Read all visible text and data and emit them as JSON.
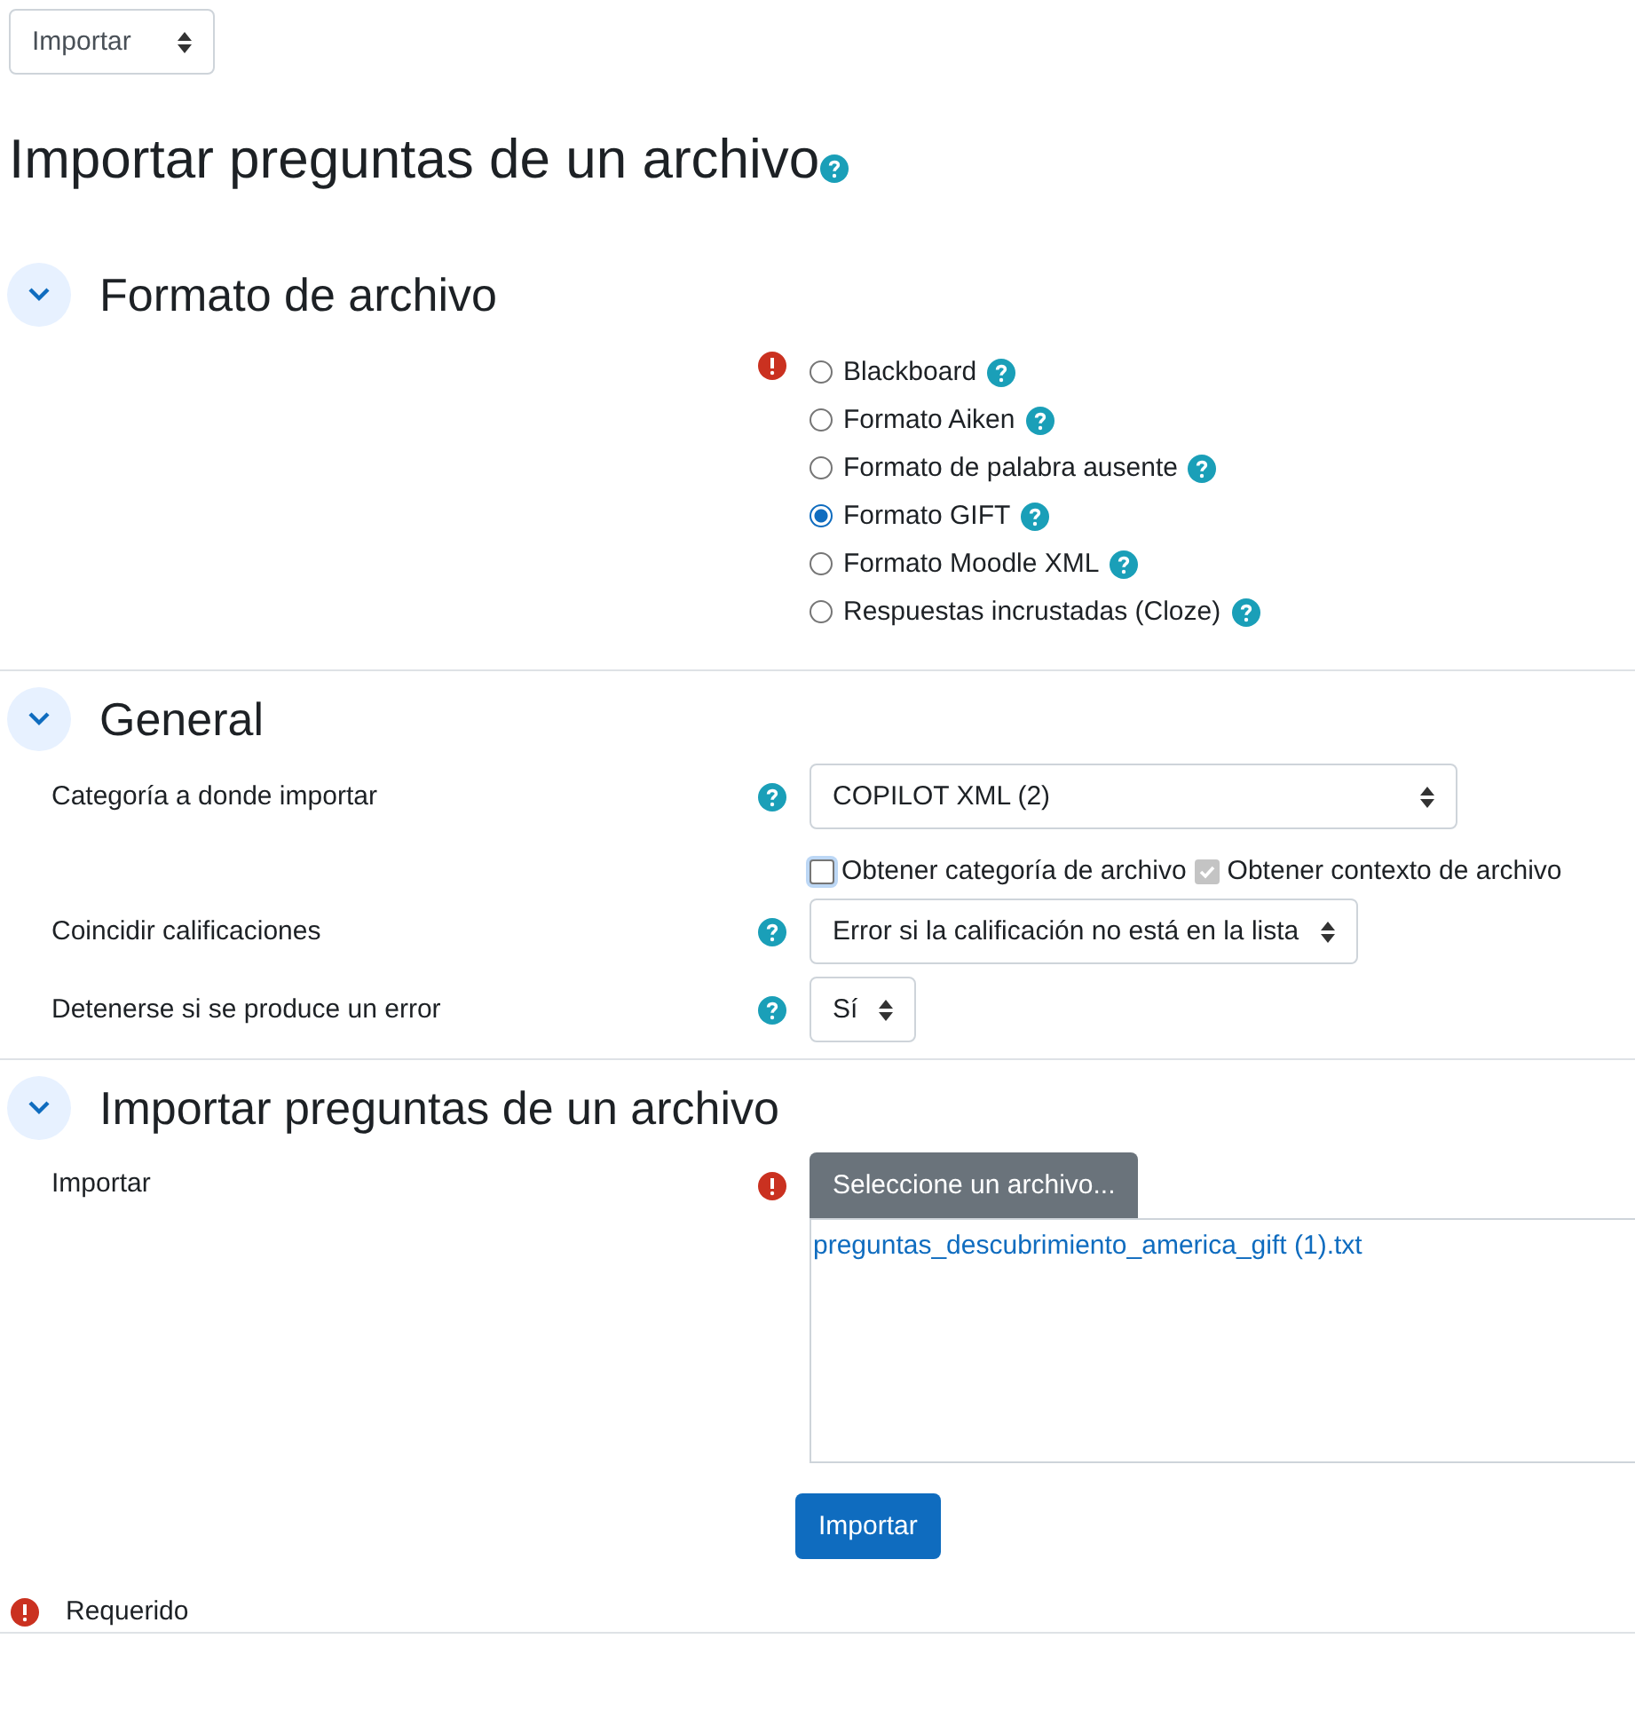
{
  "jump_select": {
    "value": "Importar"
  },
  "page_title": "Importar preguntas de un archivo",
  "sections": [
    {
      "kind": "formats",
      "title": "Formato de archivo",
      "expanded": true,
      "required": true,
      "options": [
        {
          "label": "Blackboard",
          "selected": false
        },
        {
          "label": "Formato Aiken",
          "selected": false
        },
        {
          "label": "Formato de palabra ausente",
          "selected": false
        },
        {
          "label": "Formato GIFT",
          "selected": true
        },
        {
          "label": "Formato Moodle XML",
          "selected": false
        },
        {
          "label": "Respuestas incrustadas (Cloze)",
          "selected": false
        }
      ]
    },
    {
      "kind": "general",
      "title": "General",
      "expanded": true,
      "rows": [
        {
          "kind": "select",
          "label": "Categoría a donde importar",
          "value": "COPILOT XML (2)"
        },
        {
          "kind": "checkboxes",
          "items": [
            {
              "label": "Obtener categoría de archivo",
              "checked": false,
              "disabled": false
            },
            {
              "label": "Obtener contexto de archivo",
              "checked": true,
              "disabled": true
            }
          ]
        },
        {
          "kind": "select",
          "label": "Coincidir calificaciones",
          "value": "Error si la calificación no está en la lista"
        },
        {
          "kind": "select",
          "label": "Detenerse si se produce un error",
          "value": "Sí"
        }
      ]
    },
    {
      "kind": "file",
      "title": "Importar preguntas de un archivo",
      "expanded": true,
      "label": "Importar",
      "required": true,
      "button": "Seleccione un archivo...",
      "file": "preguntas_descubrimiento_america_gift (1).txt"
    }
  ],
  "submit_button": "Importar",
  "required_note": "Requerido"
}
